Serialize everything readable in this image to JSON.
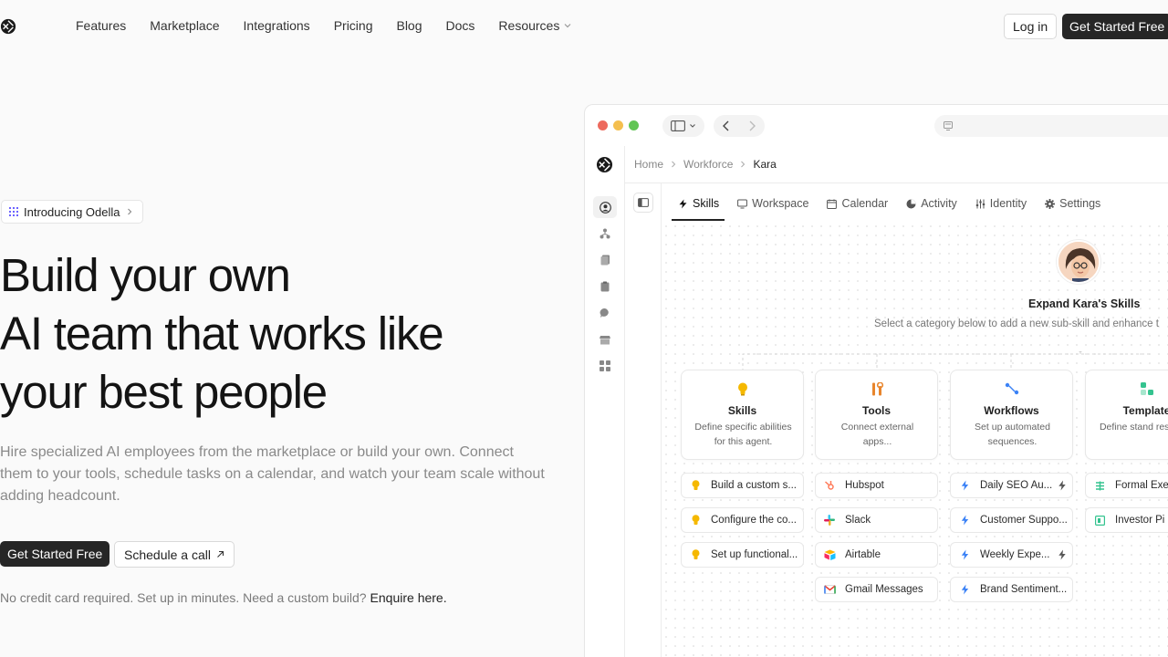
{
  "nav": {
    "links": [
      {
        "label": "Features"
      },
      {
        "label": "Marketplace"
      },
      {
        "label": "Integrations"
      },
      {
        "label": "Pricing"
      },
      {
        "label": "Blog"
      },
      {
        "label": "Docs"
      },
      {
        "label": "Resources"
      }
    ],
    "login_label": "Log in",
    "cta_label": "Get Started Free"
  },
  "hero": {
    "pill_label": "Introducing Odella",
    "headline_line1": "Build your own",
    "headline_line2": "AI team that works like",
    "headline_line3": "your best people",
    "subtitle": "Hire specialized AI employees from the marketplace or build your own. Connect them to your tools, schedule tasks on a calendar, and watch your team scale without adding headcount.",
    "primary_cta": "Get Started Free",
    "secondary_cta": "Schedule a call",
    "note": "No credit card required. Set up in minutes. Need a custom build?",
    "note_link": "Enquire here."
  },
  "app": {
    "breadcrumb": [
      "Home",
      "Workforce",
      "Kara"
    ],
    "tabs": [
      {
        "label": "Skills",
        "icon": "bolt-icon"
      },
      {
        "label": "Workspace",
        "icon": "monitor-icon"
      },
      {
        "label": "Calendar",
        "icon": "calendar-icon"
      },
      {
        "label": "Activity",
        "icon": "activity-icon"
      },
      {
        "label": "Identity",
        "icon": "sliders-icon"
      },
      {
        "label": "Settings",
        "icon": "gear-icon"
      }
    ],
    "expand_title": "Expand Kara's Skills",
    "expand_subtitle": "Select a category below to add a new sub-skill and enhance t",
    "cards": [
      {
        "title": "Skills",
        "desc": "Define specific abilities for this agent.",
        "icon": "lightbulb-icon"
      },
      {
        "title": "Tools",
        "desc": "Connect external apps...",
        "icon": "tools-icon"
      },
      {
        "title": "Workflows",
        "desc": "Set up automated sequences.",
        "icon": "workflow-icon"
      },
      {
        "title": "Template",
        "desc": "Define stand response",
        "icon": "template-icon"
      }
    ],
    "skills_items": [
      "Build a custom s...",
      "Configure the co...",
      "Set up functional..."
    ],
    "tools_items": [
      "Hubspot",
      "Slack",
      "Airtable",
      "Gmail Messages"
    ],
    "workflow_items": [
      "Daily SEO Au...",
      "Customer Suppo...",
      "Weekly Expe...",
      "Brand Sentiment..."
    ],
    "template_items": [
      "Formal Exe",
      "Investor Pi"
    ]
  },
  "colors": {
    "accent_dark": "#262626",
    "traffic_red": "#ed6a5e",
    "traffic_yellow": "#f4bf4f",
    "traffic_green": "#61c554",
    "bolt_blue": "#3b82f6",
    "skill_yellow": "#f5b800"
  }
}
